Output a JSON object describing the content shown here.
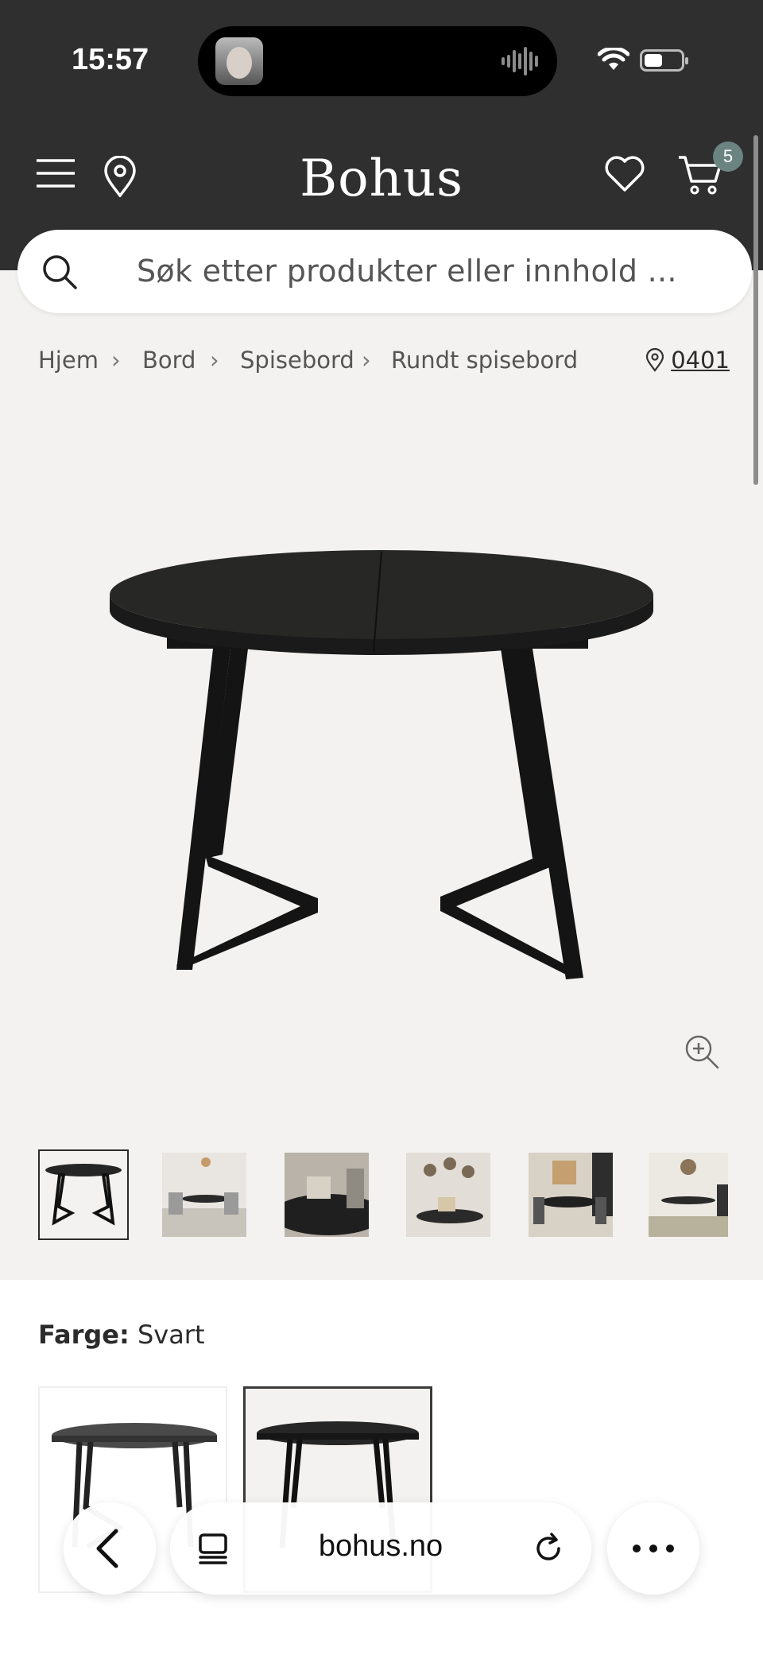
{
  "status_bar": {
    "time": "15:57"
  },
  "header": {
    "logo": "Bohus",
    "cart_count": "5",
    "icons": [
      "hamburger-menu-icon",
      "location-pin-icon",
      "heart-icon",
      "cart-icon"
    ],
    "background_color": "#2f2f30"
  },
  "search": {
    "placeholder": "Søk etter produkter eller innhold ..."
  },
  "breadcrumb": {
    "items": [
      "Hjem",
      "Bord",
      "Spisebord",
      "Rundt spisebord"
    ],
    "postcode": "0401"
  },
  "product": {
    "color_label": "Farge:",
    "color_value": "Svart"
  },
  "browser": {
    "url": "bohus.no"
  }
}
